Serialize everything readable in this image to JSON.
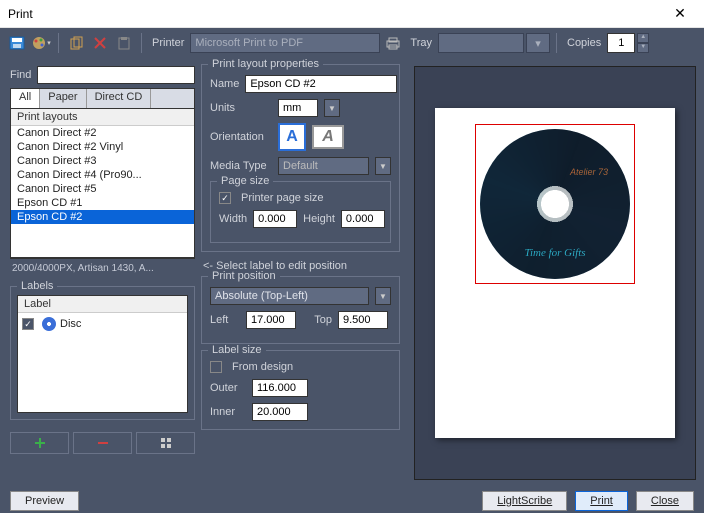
{
  "window": {
    "title": "Print"
  },
  "toolbar": {
    "printer_label": "Printer",
    "printer_value": "Microsoft Print to PDF",
    "tray_label": "Tray",
    "tray_value": "",
    "copies_label": "Copies",
    "copies_value": "1"
  },
  "find": {
    "label": "Find",
    "value": ""
  },
  "tabs": [
    "All",
    "Paper",
    "Direct CD"
  ],
  "active_tab": "All",
  "list": {
    "header": "Print layouts",
    "items": [
      "Canon Direct #2",
      "Canon Direct #2 Vinyl",
      "Canon Direct #3",
      "Canon Direct #4 (Pro90...",
      "Canon Direct #5",
      "Epson CD #1",
      "Epson CD #2"
    ],
    "selected": "Epson CD #2",
    "footer": "2000/4000PX, Artisan 1430, A..."
  },
  "labels_group": {
    "title": "Labels",
    "header": "Label",
    "items": [
      {
        "checked": true,
        "icon": "disc",
        "name": "Disc"
      }
    ]
  },
  "action_buttons": {
    "add": "+",
    "remove": "−",
    "grid": "grid"
  },
  "layout_props": {
    "title": "Print layout properties",
    "name_label": "Name",
    "name_value": "Epson CD #2",
    "units_label": "Units",
    "units_value": "mm",
    "orientation_label": "Orientation",
    "media_label": "Media Type",
    "media_value": "Default",
    "page_size": {
      "title": "Page size",
      "printer_chk_label": "Printer page size",
      "printer_chk": true,
      "width_label": "Width",
      "width_value": "0.000",
      "height_label": "Height",
      "height_value": "0.000"
    }
  },
  "edit_hint": "<- Select label to edit position",
  "print_position": {
    "title": "Print position",
    "mode": "Absolute (Top-Left)",
    "left_label": "Left",
    "left_value": "17.000",
    "top_label": "Top",
    "top_value": "9.500"
  },
  "label_size": {
    "title": "Label size",
    "from_design_label": "From design",
    "from_design": false,
    "outer_label": "Outer",
    "outer_value": "116.000",
    "inner_label": "Inner",
    "inner_value": "20.000"
  },
  "preview_art": {
    "line1": "Atelier 73",
    "line2": "Time for Gifts"
  },
  "footer": {
    "preview": "Preview",
    "lightscribe": "LightScribe",
    "print": "Print",
    "close": "Close"
  }
}
